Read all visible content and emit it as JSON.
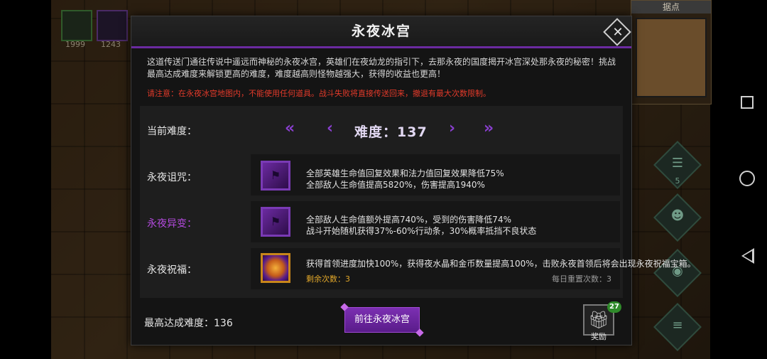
{
  "inventory": [
    {
      "count": "1999"
    },
    {
      "count": "1243"
    }
  ],
  "minimap": {
    "title": "据点"
  },
  "side_badge": "5",
  "dialog": {
    "title": "永夜冰宫",
    "description": "这道传送门通往传说中遥远而神秘的永夜冰宫，英雄们在夜幼龙的指引下，去那永夜的国度揭开冰宫深处那永夜的秘密！挑战最高达成难度来解锁更高的难度，难度越高则怪物越强大，获得的收益也更高！",
    "warning": "请注意：在永夜冰宫地图内，不能使用任何道具。战斗失败将直接传送回来，撤退有最大次数限制。"
  },
  "difficulty": {
    "label": "当前难度：",
    "value_text": "难度：137",
    "first_icon": "«",
    "prev_icon": "‹",
    "next_icon": "›",
    "last_icon": "»"
  },
  "curse": {
    "label": "永夜诅咒：",
    "line1": "全部英雄生命值回复效果和法力值回复效果降低75%",
    "line2": "全部敌人生命值提高5820%，伤害提高1940%"
  },
  "mutation": {
    "label": "永夜异变：",
    "line1": "全部敌人生命值额外提高740%，受到的伤害降低74%",
    "line2": "战斗开始随机获得37%-60%行动条，30%概率抵挡不良状态"
  },
  "blessing": {
    "label": "永夜祝福：",
    "line1": "获得首领进度加快100%，获得夜水晶和金币数量提高100%，击败永夜首领后将会出现永夜祝福宝箱。",
    "remaining": "剩余次数：3",
    "daily_reset": "每日重置次数：3"
  },
  "footer": {
    "best_label": "最高达成难度：136",
    "go_button": "前往永夜冰宫",
    "reward_badge": "27",
    "reward_label": "奖励"
  },
  "colors": {
    "accent_purple": "#6b2aa0",
    "warning_red": "#e23a2a",
    "gold_text": "#e3a82a"
  }
}
